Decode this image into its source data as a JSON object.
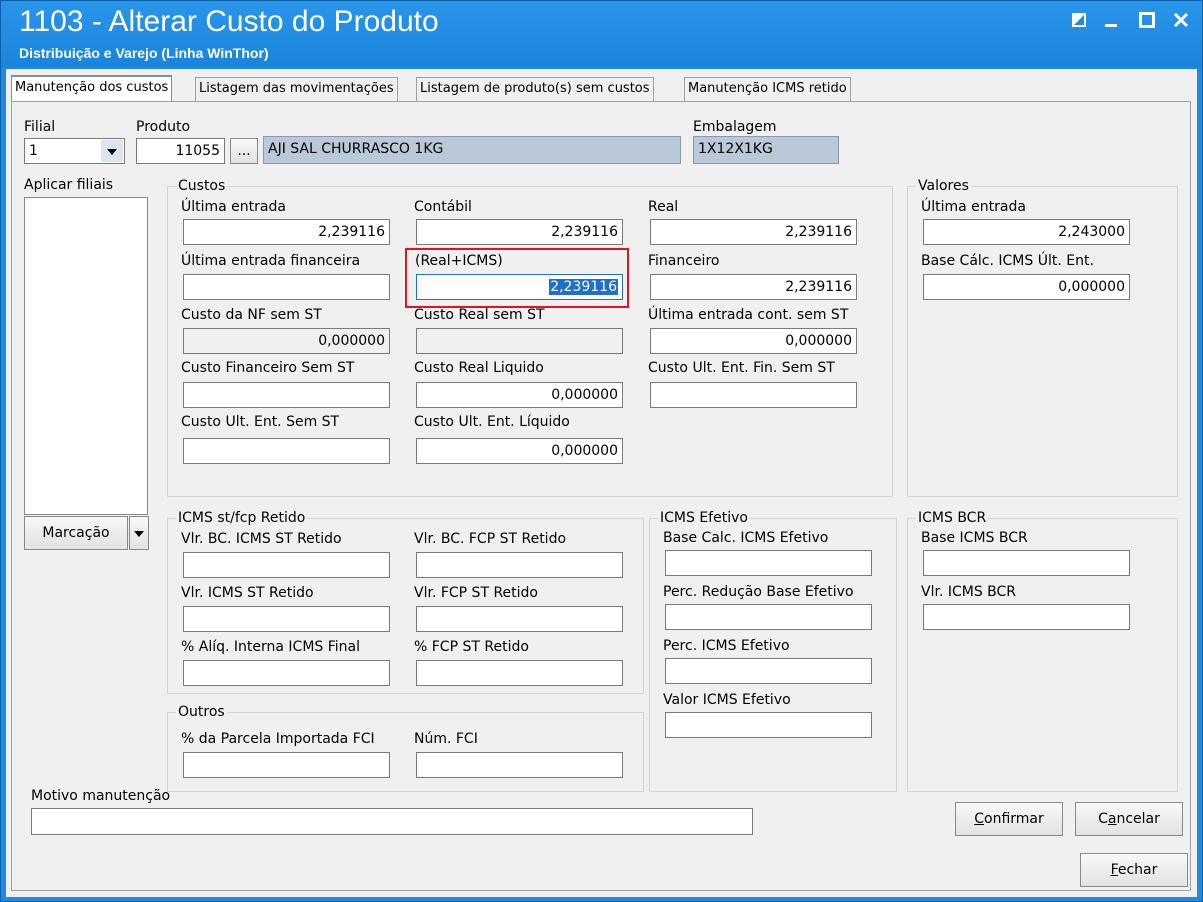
{
  "window": {
    "title": "1103 - Alterar Custo do Produto",
    "subtitle": "Distribuição e Varejo (Linha WinThor)"
  },
  "tabs": [
    {
      "label": "Manutenção dos custos",
      "active": true
    },
    {
      "label": "Listagem das movimentações",
      "active": false
    },
    {
      "label": "Listagem de produto(s)  sem custos",
      "active": false
    },
    {
      "label": "Manutenção ICMS retido",
      "active": false
    }
  ],
  "header": {
    "filial_label": "Filial",
    "filial_value": "1",
    "produto_label": "Produto",
    "produto_code": "11055",
    "produto_browse": "...",
    "produto_desc": "AJI SAL CHURRASCO 1KG",
    "embalagem_label": "Embalagem",
    "embalagem_value": "1X12X1KG"
  },
  "aplicar_filiais": {
    "label": "Aplicar filiais",
    "marcacao_button": "Marcação"
  },
  "custos": {
    "title": "Custos",
    "ultima_entrada": {
      "label": "Última entrada",
      "value": "2,239116"
    },
    "contabil": {
      "label": "Contábil",
      "value": "2,239116"
    },
    "real": {
      "label": "Real",
      "value": "2,239116"
    },
    "ultima_entrada_financeira": {
      "label": "Última entrada financeira",
      "value": ""
    },
    "real_icms": {
      "label": "(Real+ICMS)",
      "value": "2,239116"
    },
    "financeiro": {
      "label": "Financeiro",
      "value": "2,239116"
    },
    "custo_nf_sem_st": {
      "label": "Custo da NF sem ST",
      "value": "0,000000"
    },
    "custo_real_sem_st": {
      "label": "Custo Real sem ST",
      "value": ""
    },
    "ultima_entrada_cont_sem_st": {
      "label": "Última entrada cont. sem ST",
      "value": "0,000000"
    },
    "custo_financeiro_sem_st": {
      "label": "Custo Financeiro Sem ST",
      "value": ""
    },
    "custo_real_liquido": {
      "label": "Custo Real Liquido",
      "value": "0,000000"
    },
    "custo_ult_ent_fin_sem_st": {
      "label": "Custo Ult. Ent. Fin. Sem ST",
      "value": ""
    },
    "custo_ult_ent_sem_st": {
      "label": "Custo Ult. Ent. Sem ST",
      "value": ""
    },
    "custo_ult_ent_liquido": {
      "label": "Custo Ult. Ent. Líquido",
      "value": "0,000000"
    }
  },
  "valores": {
    "title": "Valores",
    "ultima_entrada": {
      "label": "Última entrada",
      "value": "2,243000"
    },
    "base_calc_icms": {
      "label": "Base Cálc. ICMS Últ. Ent.",
      "value": "0,000000"
    }
  },
  "icms_st": {
    "title": "ICMS st/fcp Retido",
    "vlr_bc_icms_st": {
      "label": "Vlr. BC. ICMS ST Retido",
      "value": ""
    },
    "vlr_bc_fcp_st": {
      "label": "Vlr. BC. FCP ST Retido",
      "value": ""
    },
    "vlr_icms_st": {
      "label": "Vlr. ICMS ST Retido",
      "value": ""
    },
    "vlr_fcp_st": {
      "label": "Vlr. FCP ST Retido",
      "value": ""
    },
    "aliq_interna": {
      "label": "% Alíq. Interna ICMS Final",
      "value": ""
    },
    "fcp_st": {
      "label": "% FCP ST Retido",
      "value": ""
    }
  },
  "icms_efetivo": {
    "title": "ICMS Efetivo",
    "base_calc": {
      "label": "Base Calc. ICMS Efetivo",
      "value": ""
    },
    "perc_reducao": {
      "label": "Perc. Redução Base Efetivo",
      "value": ""
    },
    "perc_icms": {
      "label": "Perc. ICMS Efetivo",
      "value": ""
    },
    "valor_icms": {
      "label": "Valor ICMS Efetivo",
      "value": ""
    }
  },
  "icms_bcr": {
    "title": "ICMS BCR",
    "base": {
      "label": "Base ICMS BCR",
      "value": ""
    },
    "vlr": {
      "label": "Vlr. ICMS BCR",
      "value": ""
    }
  },
  "outros": {
    "title": "Outros",
    "parcela_fci": {
      "label": "% da Parcela Importada FCI",
      "value": ""
    },
    "num_fci": {
      "label": "Núm. FCI",
      "value": ""
    }
  },
  "motivo": {
    "label": "Motivo manutenção",
    "value": ""
  },
  "buttons": {
    "confirmar_first": "C",
    "confirmar_rest": "onfirmar",
    "cancelar_pre": "C",
    "cancelar_acc": "a",
    "cancelar_rest": "ncelar",
    "fechar_first": "F",
    "fechar_rest": "echar"
  },
  "colors": {
    "titlebar": "#1f8ae0",
    "highlight_box": "#e0141e",
    "readonly_field": "#b9c9d7",
    "selection": "#1f6fcf"
  }
}
